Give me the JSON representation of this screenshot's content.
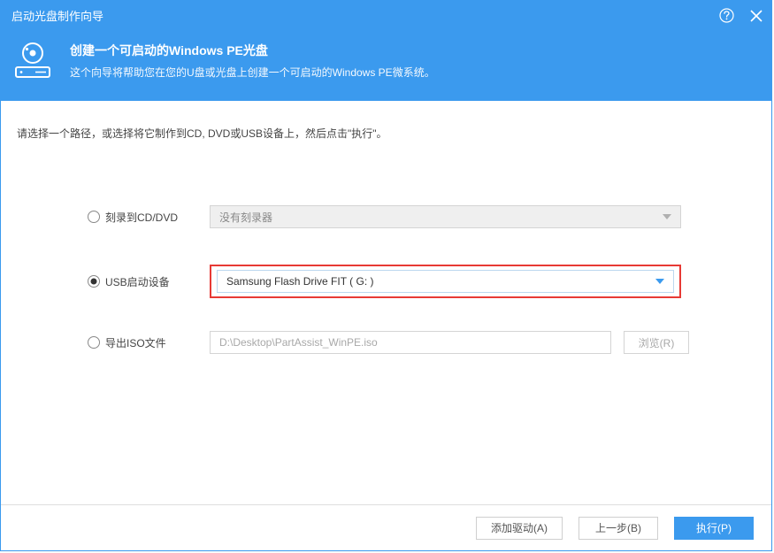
{
  "titlebar": {
    "title": "启动光盘制作向导"
  },
  "banner": {
    "title": "创建一个可启动的Windows PE光盘",
    "subtitle": "这个向导将帮助您在您的U盘或光盘上创建一个可启动的Windows PE微系统。"
  },
  "instruction": "请选择一个路径，或选择将它制作到CD, DVD或USB设备上，然后点击\"执行\"。",
  "options": {
    "cd_dvd": {
      "label": "刻录到CD/DVD",
      "selected_value": "没有刻录器"
    },
    "usb": {
      "label": "USB启动设备",
      "selected_value": "Samsung Flash Drive FIT ( G: )"
    },
    "iso": {
      "label": "导出ISO文件",
      "path": "D:\\Desktop\\PartAssist_WinPE.iso",
      "browse": "浏览(R)"
    }
  },
  "footer": {
    "add_driver": "添加驱动(A)",
    "back": "上一步(B)",
    "execute": "执行(P)"
  }
}
